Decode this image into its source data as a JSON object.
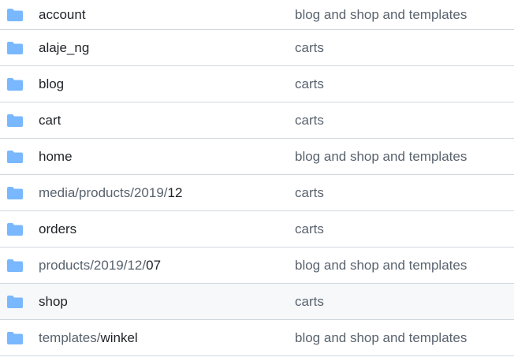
{
  "colors": {
    "folder_icon": "#79b8ff",
    "border": "#d0d7de",
    "hover_row": "#f6f8fa",
    "muted_text": "#59636e"
  },
  "rows": [
    {
      "icon": "folder-icon",
      "prefix": "",
      "name": "account",
      "commit": "blog and shop and templates"
    },
    {
      "icon": "folder-icon",
      "prefix": "",
      "name": "alaje_ng",
      "commit": "carts"
    },
    {
      "icon": "folder-icon",
      "prefix": "",
      "name": "blog",
      "commit": "carts"
    },
    {
      "icon": "folder-icon",
      "prefix": "",
      "name": "cart",
      "commit": "carts"
    },
    {
      "icon": "folder-icon",
      "prefix": "",
      "name": "home",
      "commit": "blog and shop and templates"
    },
    {
      "icon": "folder-icon",
      "prefix": "media/products/2019/",
      "name": "12",
      "commit": "carts"
    },
    {
      "icon": "folder-icon",
      "prefix": "",
      "name": "orders",
      "commit": "carts"
    },
    {
      "icon": "folder-icon",
      "prefix": "products/2019/12/",
      "name": "07",
      "commit": "blog and shop and templates"
    },
    {
      "icon": "folder-icon",
      "prefix": "",
      "name": "shop",
      "commit": "carts"
    },
    {
      "icon": "folder-icon",
      "prefix": "templates/",
      "name": "winkel",
      "commit": "blog and shop and templates"
    }
  ]
}
